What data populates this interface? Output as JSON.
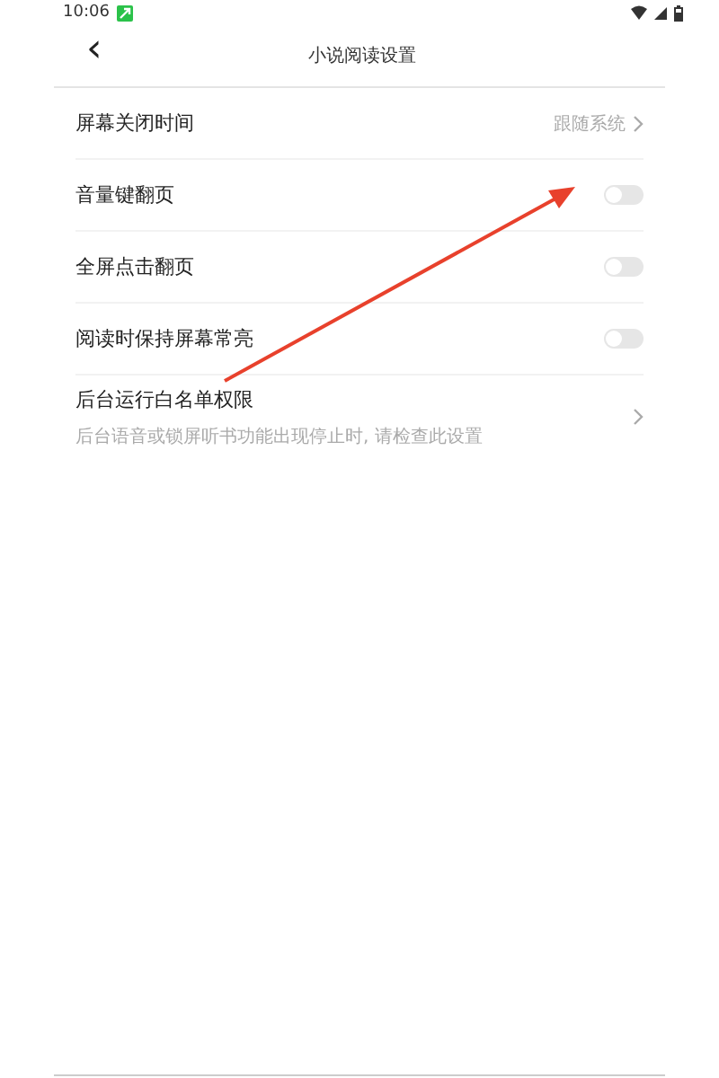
{
  "status_bar": {
    "time": "10:06"
  },
  "header": {
    "back": "‹",
    "title": "小说阅读设置"
  },
  "settings": [
    {
      "kind": "link",
      "label": "屏幕关闭时间",
      "value": "跟随系统"
    },
    {
      "kind": "toggle",
      "label": "音量键翻页",
      "on": false
    },
    {
      "kind": "toggle",
      "label": "全屏点击翻页",
      "on": false
    },
    {
      "kind": "toggle",
      "label": "阅读时保持屏幕常亮",
      "on": false
    },
    {
      "kind": "link",
      "label": "后台运行白名单权限",
      "subtitle": "后台语音或锁屏听书功能出现停止时, 请检查此设置"
    }
  ],
  "annotations": [
    {
      "kind": "arrow"
    }
  ]
}
